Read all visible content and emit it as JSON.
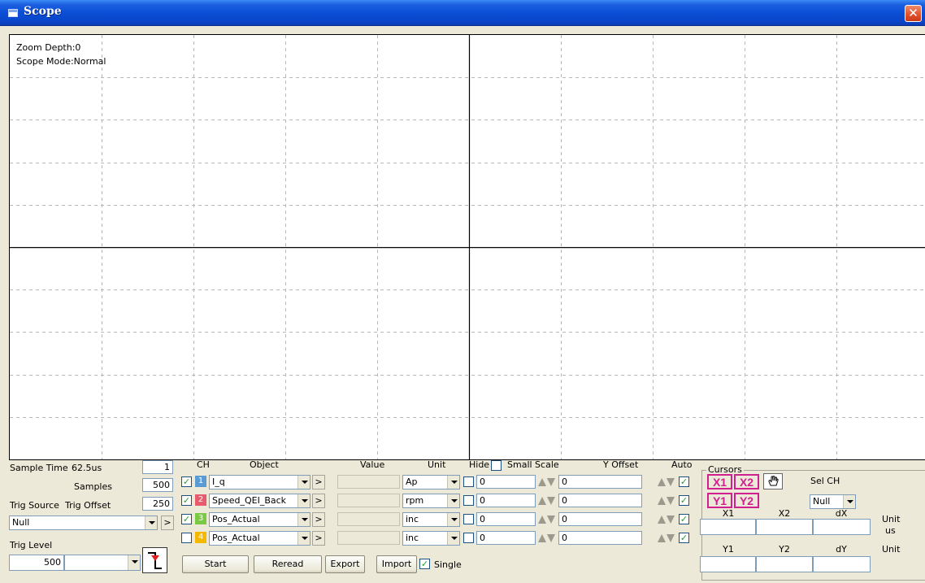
{
  "window": {
    "title": "Scope",
    "close_label": "✕"
  },
  "plot": {
    "zoom_depth": "Zoom Depth:0",
    "scope_mode": "Scope Mode:Normal",
    "grid_cols": 10,
    "grid_rows": 10
  },
  "sampling": {
    "sample_time_label": "Sample Time",
    "sample_time_value": "62.5us",
    "sample_time_box": "1",
    "samples_label": "Samples",
    "samples_value": "500",
    "trig_source_label": "Trig Source",
    "trig_offset_label": "Trig Offset",
    "trig_offset_value": "250",
    "trig_source_value": "Null",
    "trig_level_label": "Trig Level",
    "trig_level_value": "500"
  },
  "channels": {
    "headers": {
      "ch": "CH",
      "object": "Object",
      "value": "Value",
      "unit": "Unit",
      "hide": "Hide",
      "small_scale": "Small Scale",
      "y_offset": "Y Offset",
      "auto": "Auto"
    },
    "rows": [
      {
        "enabled": true,
        "num": "1",
        "color": "#5b9bd5",
        "object": "I_q",
        "unit": "Ap",
        "scale": "0",
        "offset": "0",
        "auto": true
      },
      {
        "enabled": true,
        "num": "2",
        "color": "#e85a6e",
        "object": "Speed_QEI_Back",
        "unit": "rpm",
        "scale": "0",
        "offset": "0",
        "auto": true
      },
      {
        "enabled": true,
        "num": "3",
        "color": "#7ac943",
        "object": "Pos_Actual",
        "unit": "inc",
        "scale": "0",
        "offset": "0",
        "auto": true
      },
      {
        "enabled": false,
        "num": "4",
        "color": "#f5b800",
        "object": "Pos_Actual",
        "unit": "inc",
        "scale": "0",
        "offset": "0",
        "auto": true
      }
    ],
    "go_label": ">"
  },
  "actions": {
    "start": "Start",
    "reread": "Reread",
    "export": "Export",
    "import": "Import",
    "single": "Single",
    "single_checked": true
  },
  "cursors": {
    "legend": "Cursors",
    "x1": "X1",
    "x2": "X2",
    "y1": "Y1",
    "y2": "Y2",
    "hand_icon": "hand-pointer-icon",
    "sel_ch_label": "Sel CH",
    "sel_ch_value": "Null",
    "x_headers": [
      "X1",
      "X2",
      "dX"
    ],
    "y_headers": [
      "Y1",
      "Y2",
      "dY"
    ],
    "unit_label": "Unit",
    "x_unit": "us",
    "y_unit_label": "Unit"
  }
}
